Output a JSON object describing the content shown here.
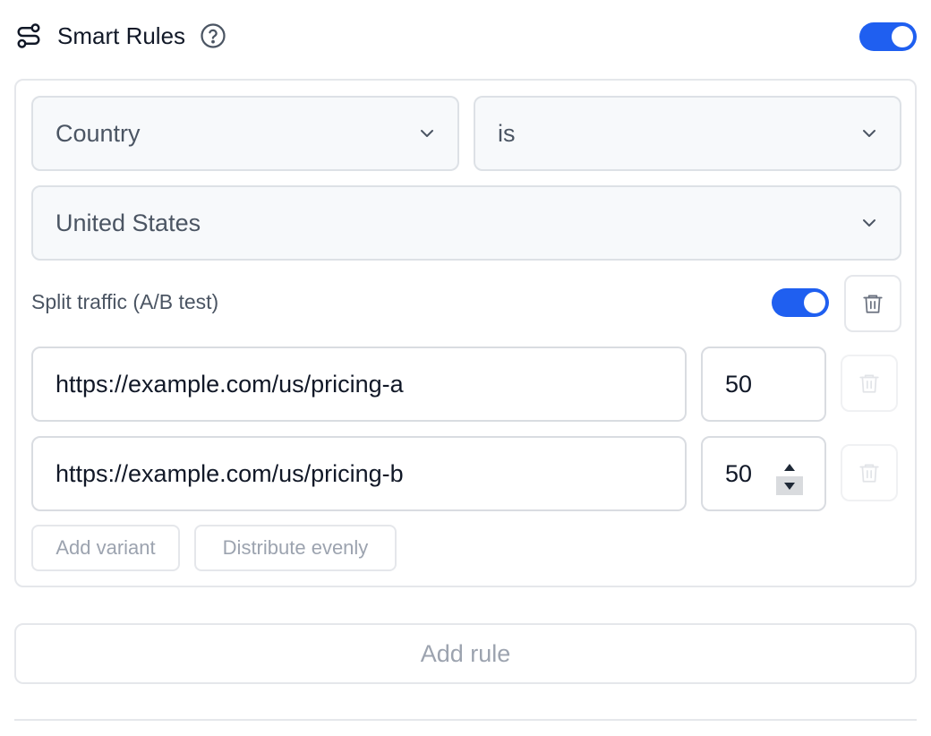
{
  "header": {
    "icon": "route-icon",
    "title": "Smart Rules",
    "help_icon": "question-circle-icon",
    "enabled": true
  },
  "rule": {
    "field_select": {
      "value": "Country"
    },
    "operator_select": {
      "value": "is"
    },
    "value_select": {
      "value": "United States"
    },
    "split": {
      "label": "Split traffic (A/B test)",
      "enabled": true
    },
    "variants": [
      {
        "url": "https://example.com/us/pricing-a",
        "weight": "50"
      },
      {
        "url": "https://example.com/us/pricing-b",
        "weight": "50"
      }
    ],
    "add_variant_label": "Add variant",
    "distribute_label": "Distribute evenly"
  },
  "add_rule_label": "Add rule",
  "colors": {
    "accent": "#1f5ff0",
    "border": "#e5e7eb",
    "select_bg": "#f7f9fb",
    "muted_text": "#9ca3af"
  }
}
